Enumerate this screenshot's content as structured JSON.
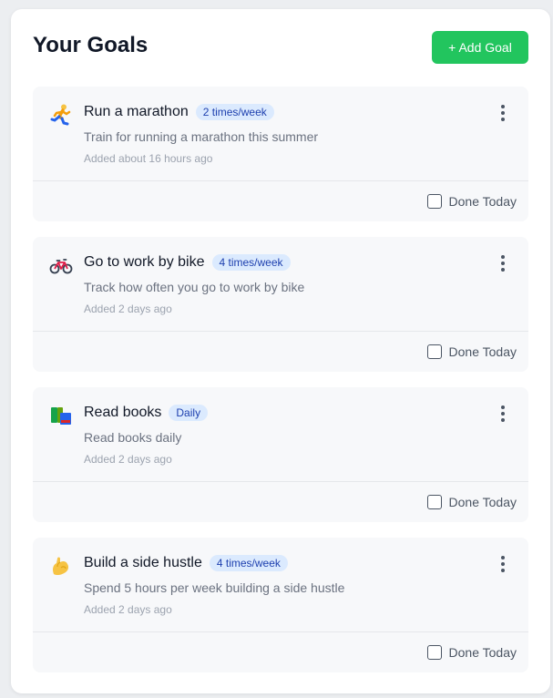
{
  "header": {
    "title": "Your Goals",
    "add_button_label": "+ Add Goal"
  },
  "colors": {
    "accent": "#22c55e",
    "badge_bg": "#dbeafe",
    "badge_text": "#1e40af",
    "card_bg": "#f7f8fa"
  },
  "goals": [
    {
      "icon": "runner-icon",
      "title": "Run a marathon",
      "frequency": "2 times/week",
      "description": "Train for running a marathon this summer",
      "added": "Added about 16 hours ago",
      "done_label": "Done Today",
      "done": false
    },
    {
      "icon": "bicycle-icon",
      "title": "Go to work by bike",
      "frequency": "4 times/week",
      "description": "Track how often you go to work by bike",
      "added": "Added 2 days ago",
      "done_label": "Done Today",
      "done": false
    },
    {
      "icon": "books-icon",
      "title": "Read books",
      "frequency": "Daily",
      "description": "Read books daily",
      "added": "Added 2 days ago",
      "done_label": "Done Today",
      "done": false
    },
    {
      "icon": "flexed-biceps-icon",
      "title": "Build a side hustle",
      "frequency": "4 times/week",
      "description": "Spend 5 hours per week building a side hustle",
      "added": "Added 2 days ago",
      "done_label": "Done Today",
      "done": false
    }
  ]
}
